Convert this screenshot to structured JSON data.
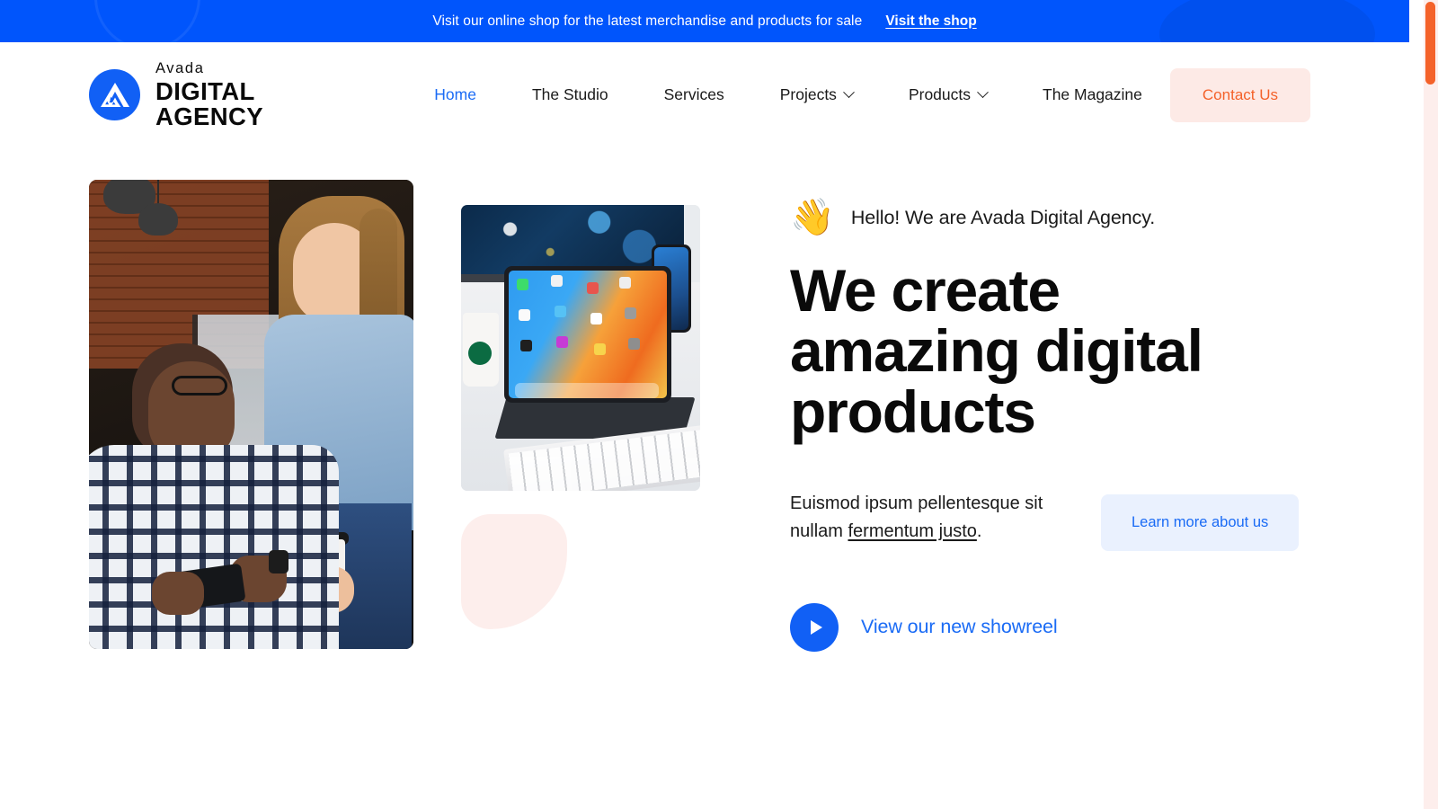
{
  "announcement": {
    "text": "Visit our online shop for the latest merchandise and products for sale",
    "link_label": "Visit the shop",
    "background_color": "#0055fc",
    "text_color": "#ffffff"
  },
  "header": {
    "logo": {
      "brand_small": "Avada",
      "brand_large": "DIGITAL AGENCY",
      "mark_color": "#1160f5"
    },
    "nav_items": [
      {
        "label": "Home",
        "active": true,
        "has_dropdown": false
      },
      {
        "label": "The Studio",
        "active": false,
        "has_dropdown": false
      },
      {
        "label": "Services",
        "active": false,
        "has_dropdown": false
      },
      {
        "label": "Projects",
        "active": false,
        "has_dropdown": true
      },
      {
        "label": "Products",
        "active": false,
        "has_dropdown": true
      },
      {
        "label": "The Magazine",
        "active": false,
        "has_dropdown": false
      }
    ],
    "contact_button": {
      "label": "Contact Us",
      "background_color": "#fdeae6",
      "text_color": "#f4622a"
    },
    "active_color": "#1a6bf5"
  },
  "hero": {
    "greeting_emoji": "waving-hand-emoji",
    "greeting_text": "Hello! We are Avada Digital Agency.",
    "title_lines": [
      "We create",
      "amazing digital",
      "products"
    ],
    "paragraph_prefix": "Euismod ipsum pellentesque sit nullam ",
    "paragraph_link": "fermentum justo",
    "paragraph_suffix": ".",
    "learn_button": {
      "label": "Learn more about us",
      "background_color": "#eaf1fe",
      "text_color": "#1a6bf5"
    },
    "showreel": {
      "label": "View our new showreel",
      "icon": "play-icon",
      "accent_color": "#1160f5"
    },
    "images": {
      "people_photo_alt": "two colleagues talking in a cafe, man holding phone and woman holding coffee cup",
      "devices_photo_alt": "desk with tablet, smartphone, monitor, keyboard and coffee cup"
    },
    "decoration": {
      "blob_color": "#fdeeec"
    }
  },
  "scrollbar": {
    "thumb_color": "#f4622a",
    "track_color": "#fdeeec"
  }
}
